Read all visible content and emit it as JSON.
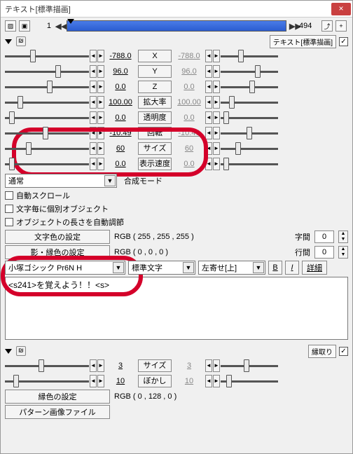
{
  "window": {
    "title": "テキスト[標準描画]"
  },
  "timeline": {
    "current": "1",
    "total": "494"
  },
  "section_label": "テキスト[標準描画]",
  "section_checked": "✓",
  "params": [
    {
      "name": "X",
      "v1": "-788.0",
      "v2": "-788.0",
      "t1": 30,
      "t2": 30
    },
    {
      "name": "Y",
      "v1": "96.0",
      "v2": "96.0",
      "t1": 60,
      "t2": 60
    },
    {
      "name": "Z",
      "v1": "0.0",
      "v2": "0.0",
      "t1": 50,
      "t2": 50
    },
    {
      "name": "拡大率",
      "v1": "100.00",
      "v2": "100.00",
      "t1": 15,
      "t2": 15
    },
    {
      "name": "透明度",
      "v1": "0.0",
      "v2": "0.0",
      "t1": 5,
      "t2": 5
    },
    {
      "name": "回転",
      "v1": "-10.49",
      "v2": "-10.49",
      "t1": 45,
      "t2": 45
    },
    {
      "name": "サイズ",
      "v1": "60",
      "v2": "60",
      "t1": 25,
      "t2": 25
    },
    {
      "name": "表示速度",
      "v1": "0.0",
      "v2": "0.0",
      "t1": 5,
      "t2": 5
    }
  ],
  "mode": {
    "select": "通常",
    "label": "合成モード"
  },
  "checks": {
    "auto_scroll": "自動スクロール",
    "per_char": "文字毎に個別オブジェクト",
    "auto_length": "オブジェクトの長さを自動調節"
  },
  "colors": {
    "text_btn": "文字色の設定",
    "text_rgb": "RGB ( 255 , 255 , 255 )",
    "shadow_btn": "影・縁色の設定",
    "shadow_rgb": "RGB ( 0 , 0 , 0 )",
    "spacing_label": "字間",
    "spacing_val": "0",
    "line_label": "行間",
    "line_val": "0"
  },
  "font": {
    "name": "小塚ゴシック Pr6N H",
    "style": "標準文字",
    "align": "左寄せ[上]",
    "b": "B",
    "i": "I",
    "detail": "詳細"
  },
  "text": "<s241>を覚えよう！！<s>",
  "border": {
    "label": "縁取り",
    "rows": [
      {
        "name": "サイズ",
        "v1": "3",
        "v2": "3",
        "t1": 40,
        "t2": 40
      },
      {
        "name": "ぼかし",
        "v1": "10",
        "v2": "10",
        "t1": 10,
        "t2": 10
      }
    ],
    "color_btn": "縁色の設定",
    "color_rgb": "RGB ( 0 , 128 , 0 )",
    "pattern_btn": "パターン画像ファイル"
  }
}
